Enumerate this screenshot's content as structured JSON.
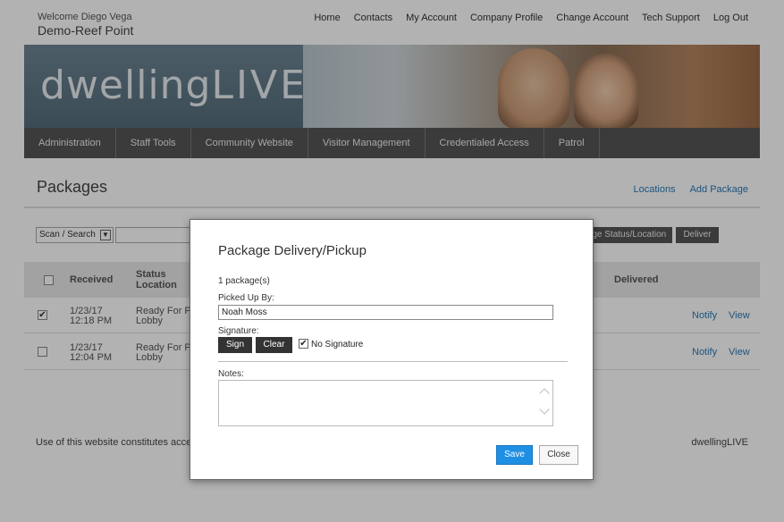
{
  "header": {
    "welcome": "Welcome Diego Vega",
    "community": "Demo-Reef Point",
    "nav": [
      "Home",
      "Contacts",
      "My Account",
      "Company Profile",
      "Change Account",
      "Tech Support",
      "Log Out"
    ]
  },
  "banner": {
    "logo_a": "dwelling",
    "logo_b": "LIVE"
  },
  "mainnav": [
    "Administration",
    "Staff Tools",
    "Community Website",
    "Visitor Management",
    "Credentialed Access",
    "Patrol"
  ],
  "packages": {
    "title": "Packages",
    "links": [
      "Locations",
      "Add Package"
    ],
    "scan_label": "Scan / Search",
    "status_button": "nge Status/Location",
    "deliver_button": "Deliver",
    "columns": {
      "received": "Received",
      "status": "Status",
      "location": "Location",
      "delivered": "Delivered"
    },
    "rows": [
      {
        "checked": true,
        "date": "1/23/17",
        "time": "12:18 PM",
        "status": "Ready For Pic",
        "location": "Lobby",
        "notify": "Notify",
        "view": "View"
      },
      {
        "checked": false,
        "date": "1/23/17",
        "time": "12:04 PM",
        "status": "Ready For Pic",
        "location": "Lobby",
        "notify": "Notify",
        "view": "View"
      }
    ]
  },
  "footer": {
    "left": "Use of this website constitutes acceptan",
    "right": "dwellingLIVE"
  },
  "modal": {
    "title": "Package Delivery/Pickup",
    "count": "1 package(s)",
    "picked_up_label": "Picked Up By:",
    "picked_up_value": "Noah Moss",
    "signature_label": "Signature:",
    "sign_button": "Sign",
    "clear_button": "Clear",
    "no_signature_label": "No Signature",
    "no_signature_checked": "✔",
    "notes_label": "Notes:",
    "save_button": "Save",
    "close_button": "Close"
  },
  "colors": {
    "accent": "#1f8fe4",
    "link": "#2a7ab8",
    "nav_bg": "#555555"
  }
}
